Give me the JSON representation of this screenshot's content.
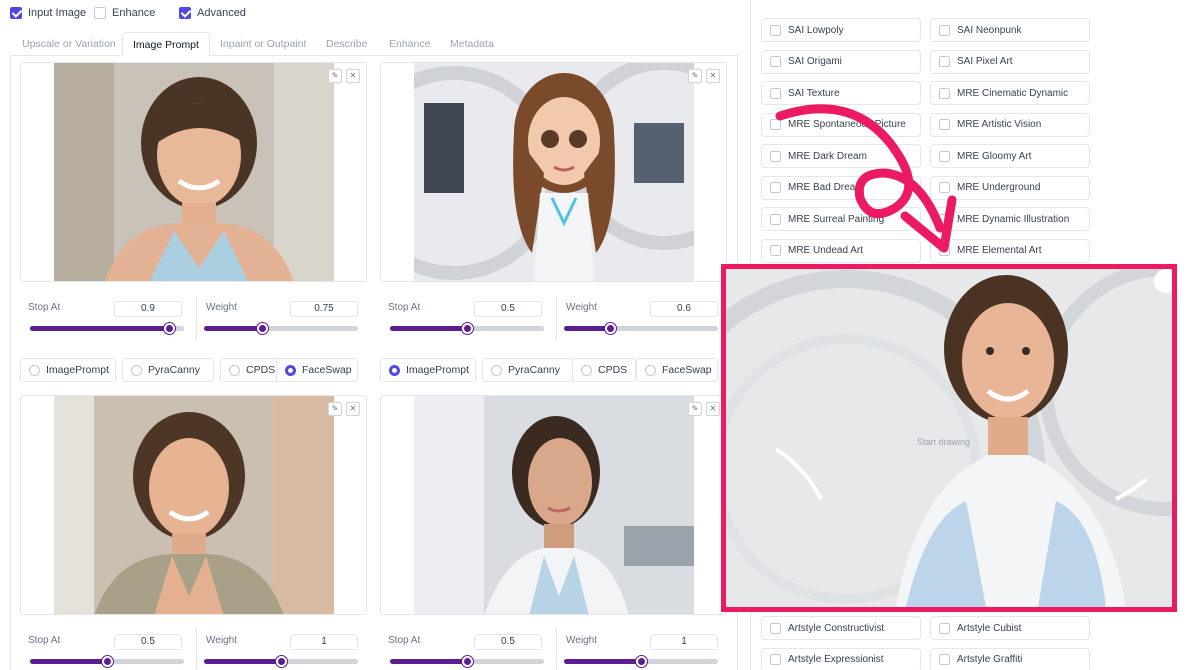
{
  "top_checkboxes": [
    {
      "label": "Input Image",
      "checked": true
    },
    {
      "label": "Enhance",
      "checked": false
    },
    {
      "label": "Advanced",
      "checked": true
    }
  ],
  "tabs": [
    {
      "label": "Upscale or Variation",
      "active": false
    },
    {
      "label": "Image Prompt",
      "active": true
    },
    {
      "label": "Inpaint or Outpaint",
      "active": false
    },
    {
      "label": "Describe",
      "active": false
    },
    {
      "label": "Enhance",
      "active": false
    },
    {
      "label": "Metadata",
      "active": false
    }
  ],
  "image_controls": {
    "edit_icon": "pencil-icon",
    "close_icon": "close-icon",
    "edit_glyph": "✎",
    "close_glyph": "✕"
  },
  "slots": [
    {
      "stop_label": "Stop At",
      "stop": "0.9",
      "stop_frac": 0.9,
      "weight_label": "Weight",
      "weight": "0.75",
      "weight_frac": 0.375,
      "radios": [
        "ImagePrompt",
        "PyraCanny",
        "CPDS",
        "FaceSwap"
      ],
      "selected": "FaceSwap"
    },
    {
      "stop_label": "Stop At",
      "stop": "0.5",
      "stop_frac": 0.5,
      "weight_label": "Weight",
      "weight": "0.6",
      "weight_frac": 0.3,
      "radios": [
        "ImagePrompt",
        "PyraCanny",
        "CPDS",
        "FaceSwap"
      ],
      "selected": "ImagePrompt"
    },
    {
      "stop_label": "Stop At",
      "stop": "0.5",
      "stop_frac": 0.5,
      "weight_label": "Weight",
      "weight": "1",
      "weight_frac": 0.5
    },
    {
      "stop_label": "Stop At",
      "stop": "0.5",
      "stop_frac": 0.5,
      "weight_label": "Weight",
      "weight": "1",
      "weight_frac": 0.5
    }
  ],
  "styles_top": [
    [
      "SAI Lowpoly",
      "SAI Neonpunk"
    ],
    [
      "SAI Origami",
      "SAI Pixel Art"
    ],
    [
      "SAI Texture",
      "MRE Cinematic Dynamic"
    ],
    [
      "MRE Spontaneous Picture",
      "MRE Artistic Vision"
    ],
    [
      "MRE Dark Dream",
      "MRE Gloomy Art"
    ],
    [
      "MRE Bad Dream",
      "MRE Underground"
    ],
    [
      "MRE Surreal Painting",
      "MRE Dynamic Illustration"
    ],
    [
      "MRE Undead Art",
      "MRE Elemental Art"
    ]
  ],
  "styles_bottom": [
    [
      "Artstyle Constructivist",
      "Artstyle Cubist"
    ],
    [
      "Artstyle Expressionist",
      "Artstyle Graffiti"
    ]
  ],
  "result": {
    "hint": "Start drawing"
  },
  "colors": {
    "accent": "#4f46e5",
    "slider": "#5b1d8f",
    "highlight": "#ec1a63"
  }
}
